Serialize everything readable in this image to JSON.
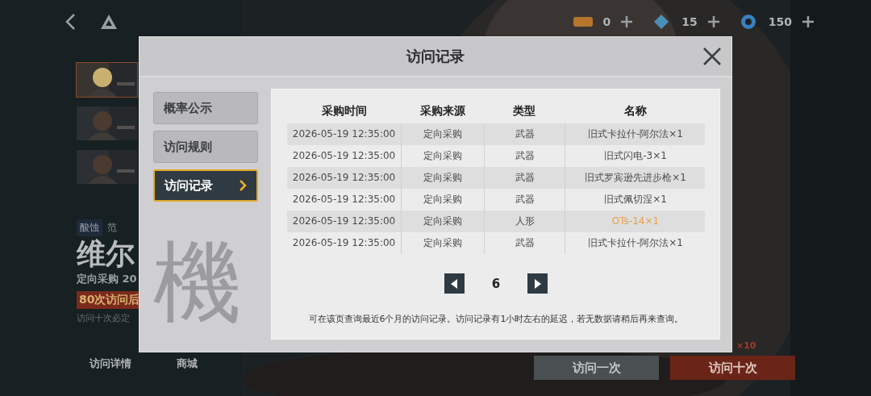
{
  "top_bar": {
    "currencies": [
      {
        "amount": "0",
        "kind": "ticket"
      },
      {
        "amount": "15",
        "kind": "crystal"
      },
      {
        "amount": "150",
        "kind": "coin"
      }
    ]
  },
  "banner": {
    "tag": "酸蚀",
    "tag_2": "范",
    "title": "维尔",
    "subtitle": "定向采购 20",
    "badge": "80次访问后",
    "hint": "访问十次必定",
    "links": [
      "访问详情",
      "商城"
    ],
    "multiplier": "×10",
    "buttons": [
      {
        "label": "访问一次",
        "kind": "secondary"
      },
      {
        "label": "访问十次",
        "kind": "primary"
      }
    ]
  },
  "dialog": {
    "title": "访问记录",
    "decor_glyph": "機",
    "tabs": [
      {
        "label": "概率公示",
        "selected": false
      },
      {
        "label": "访问规则",
        "selected": false
      },
      {
        "label": "访问记录",
        "selected": true
      }
    ],
    "table": {
      "columns": [
        "采购时间",
        "采购来源",
        "类型",
        "名称"
      ],
      "rows": [
        {
          "cells": [
            "2026-05-19 12:35:00",
            "定向采购",
            "武器",
            "旧式卡拉什-阿尔法×1"
          ],
          "highlight": false
        },
        {
          "cells": [
            "2026-05-19 12:35:00",
            "定向采购",
            "武器",
            "旧式闪电-3×1"
          ],
          "highlight": false
        },
        {
          "cells": [
            "2026-05-19 12:35:00",
            "定向采购",
            "武器",
            "旧式罗宾逊先进步枪×1"
          ],
          "highlight": false
        },
        {
          "cells": [
            "2026-05-19 12:35:00",
            "定向采购",
            "武器",
            "旧式佩切涅×1"
          ],
          "highlight": false
        },
        {
          "cells": [
            "2026-05-19 12:35:00",
            "定向采购",
            "人形",
            "OTs-14×1"
          ],
          "highlight": true
        },
        {
          "cells": [
            "2026-05-19 12:35:00",
            "定向采购",
            "武器",
            "旧式卡拉什-阿尔法×1"
          ],
          "highlight": false
        }
      ]
    },
    "pagination": {
      "page": "6"
    },
    "note": "可在该页查询最近6个月的访问记录。访问记录有1小时左右的延迟，若无数据请稍后再来查询。"
  }
}
